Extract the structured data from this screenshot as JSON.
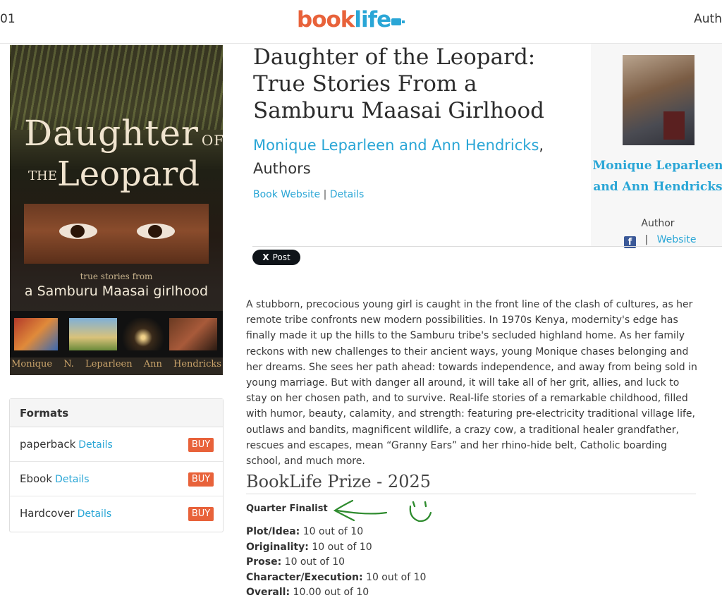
{
  "header": {
    "left_text": "01",
    "logo_part1": "book",
    "logo_part2": "life",
    "right_text": "Auth"
  },
  "cover": {
    "title_line1": "Daughter",
    "title_of": "OF",
    "title_the": "THE",
    "title_line2": "Leopard",
    "subtitle_small": "true stories from",
    "subtitle_main": "a Samburu Maasai girlhood",
    "authors": "Monique N. Leparleen Ann Hendricks"
  },
  "book": {
    "title": "Daughter of the Leopard: True Stories From a Samburu Maasai Girlhood",
    "authors_link": "Monique Leparleen and Ann Hendricks",
    "authors_comma": ",",
    "authors_role": "Authors",
    "website_link": "Book Website",
    "separator": "|",
    "details_link": "Details",
    "description": "A stubborn, precocious young girl is caught in the front line of the clash of cultures, as her remote tribe confronts new modern possibilities. In 1970s Kenya, modernity's edge has finally made it up the hills to the Samburu tribe's secluded highland home. As her family reckons with new challenges to their ancient ways, young Monique chases belonging and her dreams. She sees her path ahead: towards independence, and away from being sold in young marriage. But with danger all around, it will take all of her grit, allies, and luck to stay on her chosen path, and to survive. Real-life stories of a remarkable childhood, filled with humor, beauty, calamity, and strength: featuring pre-electricity traditional village life, outlaws and bandits, magnificent wildlife, a crazy cow, a traditional healer grandfather, rescues and escapes, mean “Granny Ears” and her rhino-hide belt, Catholic boarding school, and much more."
  },
  "author_box": {
    "name": "Monique Leparleen and Ann Hendricks",
    "role": "Author",
    "fb_glyph": "f",
    "separator": "|",
    "website_link": "Website"
  },
  "share": {
    "x_glyph": "X",
    "post_label": "Post"
  },
  "prize": {
    "title": "BookLife Prize - 2025",
    "status": "Quarter Finalist",
    "scores": [
      {
        "label": "Plot/Idea:",
        "value": "10 out of 10"
      },
      {
        "label": "Originality:",
        "value": "10 out of 10"
      },
      {
        "label": "Prose:",
        "value": "10 out of 10"
      },
      {
        "label": "Character/Execution:",
        "value": "10 out of 10"
      },
      {
        "label": "Overall:",
        "value": "10.00 out of 10"
      }
    ]
  },
  "formats": {
    "heading": "Formats",
    "items": [
      {
        "name": "paperback",
        "details": "Details",
        "buy": "BUY"
      },
      {
        "name": "Ebook",
        "details": "Details",
        "buy": "BUY"
      },
      {
        "name": "Hardcover",
        "details": "Details",
        "buy": "BUY"
      }
    ]
  },
  "colors": {
    "accent_blue": "#2aa6d6",
    "brand_orange": "#e8623a",
    "doodle_green": "#2e8b2e"
  }
}
